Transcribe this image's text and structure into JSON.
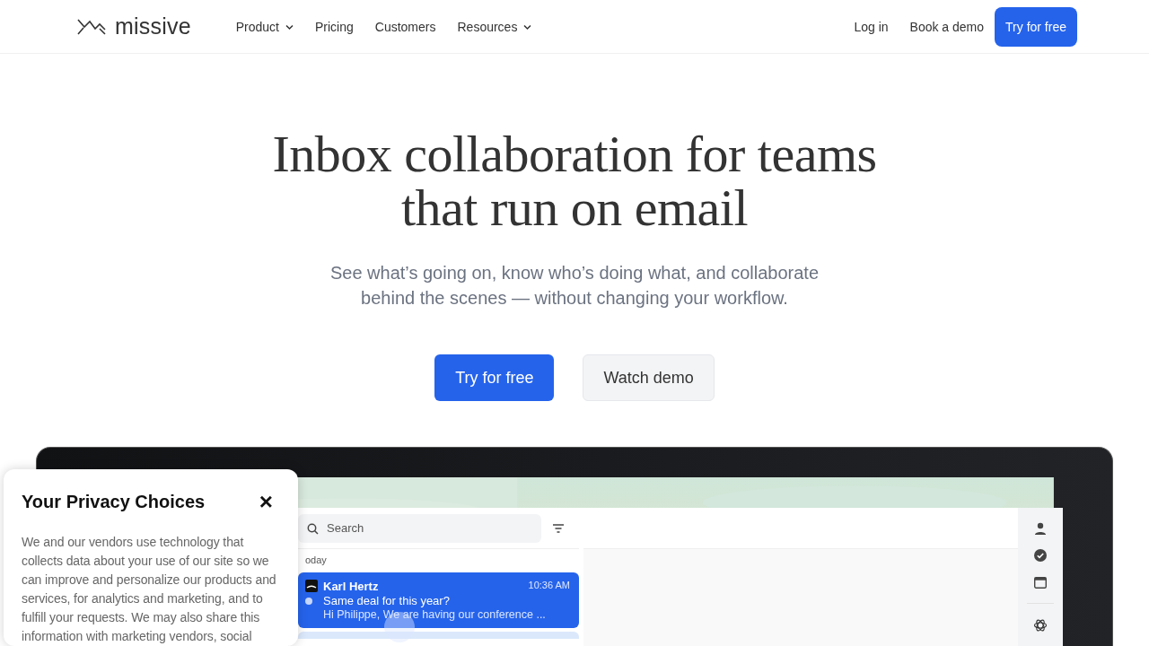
{
  "nav": {
    "brand": "missive",
    "links": [
      {
        "label": "Product",
        "dropdown": true
      },
      {
        "label": "Pricing",
        "dropdown": false
      },
      {
        "label": "Customers",
        "dropdown": false
      },
      {
        "label": "Resources",
        "dropdown": true
      }
    ],
    "login": "Log in",
    "demo": "Book a demo",
    "cta": "Try for free"
  },
  "hero": {
    "title": "Inbox collaboration for teams that run on email",
    "subtitle": "See what’s going on, know who’s doing what, and collaborate behind the scenes — without changing your workflow.",
    "primary": "Try for free",
    "secondary": "Watch demo"
  },
  "app": {
    "search_placeholder": "Search",
    "group": "oday",
    "conversations": [
      {
        "sender": "Karl Hertz",
        "time": "10:36 AM",
        "subject": "Same deal for this year?",
        "preview": "Hi Philippe, We are having our conference ...",
        "unread": true,
        "selected": true
      }
    ]
  },
  "privacy": {
    "title": "Your Privacy Choices",
    "close": "×",
    "body": "We and our vendors use technology that collects data about your use of our site so we can improve and personalize our products and services, for analytics and marketing, and to fulfill your requests. We may also share this information with marketing vendors, social"
  }
}
